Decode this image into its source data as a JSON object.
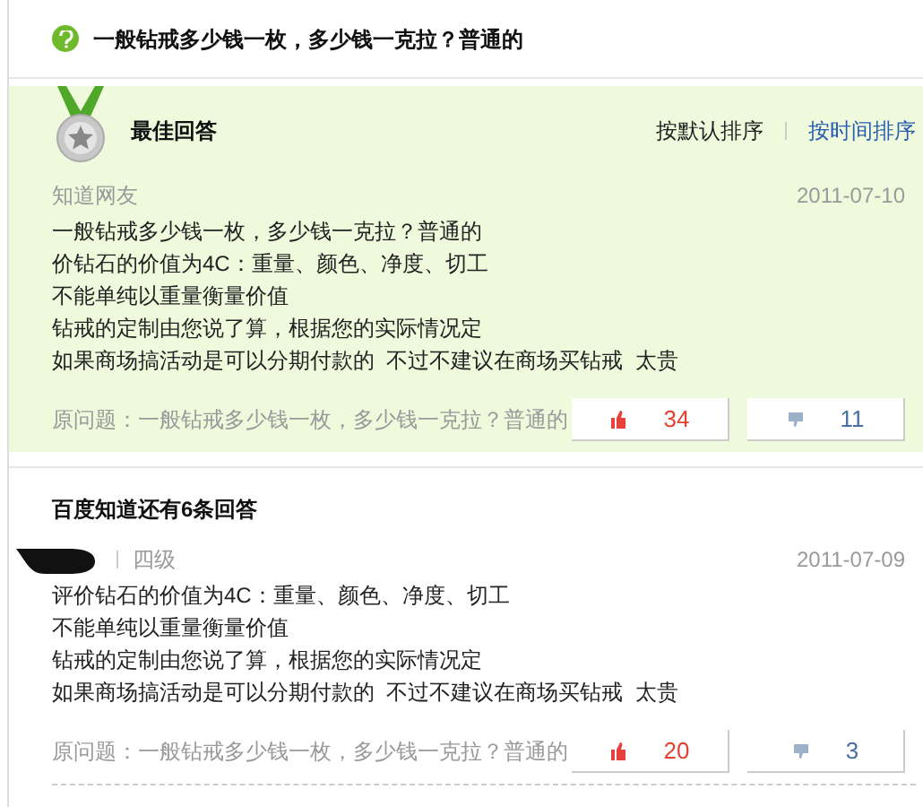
{
  "question": {
    "title": "一般钻戒多少钱一枚，多少钱一克拉？普通的"
  },
  "best_answer": {
    "heading": "最佳回答",
    "sort_options": [
      {
        "label": "按默认排序",
        "selected": true
      },
      {
        "label": "按时间排序",
        "selected": false
      }
    ],
    "author": "知道网友",
    "date": "2011-07-10",
    "lines": [
      "一般钻戒多少钱一枚，多少钱一克拉？普通的",
      "价钻石的价值为4C：重量、颜色、净度、切工",
      "不能单纯以重量衡量价值",
      "钻戒的定制由您说了算，根据您的实际情况定",
      "如果商场搞活动是可以分期付款的  不过不建议在商场买钻戒  太贵"
    ],
    "original_question": "原问题：一般钻戒多少钱一枚，多少钱一克拉？普通的",
    "up": "34",
    "down": "11"
  },
  "more_answers": {
    "heading": "百度知道还有6条回答",
    "answers": [
      {
        "level": "四级",
        "date": "2011-07-09",
        "lines": [
          "评价钻石的价值为4C：重量、颜色、净度、切工",
          "不能单纯以重量衡量价值",
          "钻戒的定制由您说了算，根据您的实际情况定",
          "如果商场搞活动是可以分期付款的  不过不建议在商场买钻戒  太贵"
        ],
        "original_question": "原问题：一般钻戒多少钱一枚，多少钱一克拉？普通的",
        "up": "20",
        "down": "3"
      }
    ]
  }
}
